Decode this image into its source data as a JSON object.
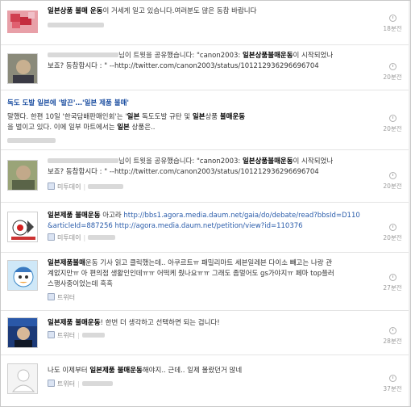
{
  "feed": [
    {
      "lines": [
        [
          {
            "t": "일본상품 불매 운동",
            "kw": true
          },
          {
            "t": "이 거세게 일고 있습니다.여러분도 많은 동참 바랍니다"
          }
        ]
      ],
      "source": "",
      "time": "18분전"
    },
    {
      "lines": [
        [
          {
            "t": "님이 트윗을 공유했습니다: \"canon2003: "
          },
          {
            "t": "일본상품불매운동",
            "kw": true
          },
          {
            "t": "이 시작되었나"
          }
        ],
        [
          {
            "t": "보죠? 동참합시다 : \" --http://twitter.com/canon2003/status/101212936296696704"
          }
        ]
      ],
      "source": "",
      "time": "20분전"
    },
    {
      "title": "독도 도발 일본에 '발끈'…'일본 제품 불매'",
      "lines": [
        [
          {
            "t": "말했다. 한편 10일 '한국담배판매인회'는 '"
          },
          {
            "t": "일본",
            "kw": true
          },
          {
            "t": " 독도도발 규탄 및 "
          },
          {
            "t": "일본",
            "kw": true
          },
          {
            "t": "상품 "
          },
          {
            "t": "불매운동",
            "kw": true
          }
        ],
        [
          {
            "t": "을 벌이고 있다. 이에 일부 마트에서는 "
          },
          {
            "t": "일본",
            "kw": true
          },
          {
            "t": " 상품은.."
          }
        ]
      ],
      "source": "",
      "time": "20분전"
    },
    {
      "lines": [
        [
          {
            "t": "님이 트윗을 공유했습니다: \"canon2003: "
          },
          {
            "t": "일본상품불매운동",
            "kw": true
          },
          {
            "t": "이 시작되었나"
          }
        ],
        [
          {
            "t": "보죠? 동참합시다 : \" --http://twitter.com/canon2003/status/101212936296696704"
          }
        ]
      ],
      "source": "미투데이",
      "time": "20분전"
    },
    {
      "lines": [
        [
          {
            "t": "일본제품 불매운동",
            "kw": true
          },
          {
            "t": " 아고라 "
          },
          {
            "t": "http://bbs1.agora.media.daum.net/gaia/do/debate/read?bbsId=D110",
            "link": true
          }
        ],
        [
          {
            "t": "&articleId=887256 http://agora.media.daum.net/petition/view?id=110376",
            "link": true
          }
        ]
      ],
      "source": "미투데이",
      "time": "20분전"
    },
    {
      "lines": [
        [
          {
            "t": "일본제품불매",
            "kw": true
          },
          {
            "t": "운동 기사 읽고 클릭했는데.. 아쿠르트ㅠ 패밀리마트 세븐일레븐 다이소 빼고는 나랑 관"
          }
        ],
        [
          {
            "t": "계없지만ㅠ 아 편의점 생활인인데ㅠㅠ 어떡케 줬나요ㅠㅠ 그래도 좀멀어도 gs가야지ㅠ 페마 top플러"
          }
        ],
        [
          {
            "t": "스행사중이었는데 흑흑"
          }
        ]
      ],
      "source": "트위터",
      "time": "27분전"
    },
    {
      "lines": [
        [
          {
            "t": "일본제품 불매운동",
            "kw": true
          },
          {
            "t": "! 한번 더 생각하고 선택하면 되는 겁니다!"
          }
        ]
      ],
      "source": "트위터",
      "time": "28분전"
    },
    {
      "lines": [
        [
          {
            "t": "나도 이제부터 "
          },
          {
            "t": "일본제품 불매운동",
            "kw": true
          },
          {
            "t": "해야지.. 근데.. 일제 몰랐던거 많네"
          }
        ]
      ],
      "source": "트위터",
      "time": "37분전"
    }
  ]
}
